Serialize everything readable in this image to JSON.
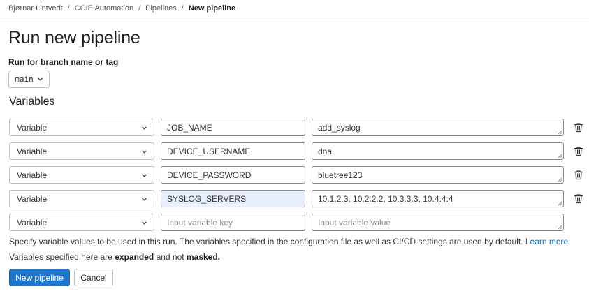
{
  "breadcrumb": {
    "items": [
      "Bjørnar Lintvedt",
      "CCIE Automation",
      "Pipelines"
    ],
    "current": "New pipeline",
    "separator": "/"
  },
  "page": {
    "title": "Run new pipeline",
    "branch_label": "Run for branch name or tag",
    "branch_value": "main",
    "variables_heading": "Variables"
  },
  "variables": [
    {
      "type": "Variable",
      "key": "JOB_NAME",
      "value": "add_syslog"
    },
    {
      "type": "Variable",
      "key": "DEVICE_USERNAME",
      "value": "dna"
    },
    {
      "type": "Variable",
      "key": "DEVICE_PASSWORD",
      "value": "bluetree123"
    },
    {
      "type": "Variable",
      "key": "SYSLOG_SERVERS",
      "value": "10.1.2.3, 10.2.2.2, 10.3.3.3, 10.4.4.4"
    }
  ],
  "new_variable": {
    "type": "Variable",
    "key_placeholder": "Input variable key",
    "value_placeholder": "Input variable value"
  },
  "help": {
    "text": "Specify variable values to be used in this run. The variables specified in the configuration file as well as CI/CD settings are used by default.",
    "link": "Learn more",
    "expand_prefix": "Variables specified here are",
    "expanded": "expanded",
    "and_not": "and not",
    "masked": "masked",
    "period": "."
  },
  "buttons": {
    "submit": "New pipeline",
    "cancel": "Cancel"
  },
  "colors": {
    "primary": "#1f75cb",
    "link": "#1068bf",
    "focused_input": "#e9f0fd"
  }
}
